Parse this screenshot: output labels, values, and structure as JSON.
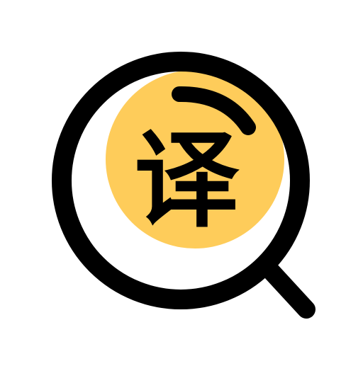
{
  "icon": {
    "name": "magnifier-translate",
    "glyph": "译",
    "colors": {
      "background": "#ffffff",
      "lens_fill": "#FECC5A",
      "outline": "#000000",
      "glyph": "#000000",
      "highlight": "#000000"
    }
  }
}
